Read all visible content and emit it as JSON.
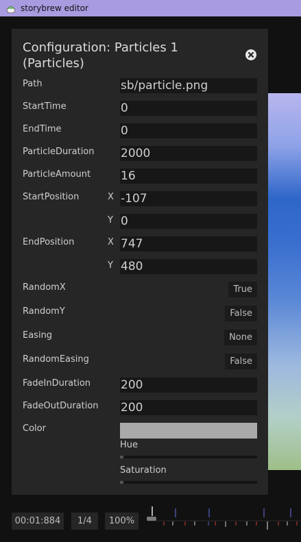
{
  "window": {
    "title": "storybrew editor"
  },
  "config": {
    "title": "Configuration: Particles 1 (Particles)",
    "fields": [
      {
        "label": "Path",
        "value": "sb/particle.png"
      },
      {
        "label": "StartTime",
        "value": "0"
      },
      {
        "label": "EndTime",
        "value": "0"
      },
      {
        "label": "ParticleDuration",
        "value": "2000"
      },
      {
        "label": "ParticleAmount",
        "value": "16"
      }
    ],
    "start_position": {
      "label": "StartPosition",
      "x_label": "X",
      "x": "-107",
      "y_label": "Y",
      "y": "0"
    },
    "end_position": {
      "label": "EndPosition",
      "x_label": "X",
      "x": "747",
      "y_label": "Y",
      "y": "480"
    },
    "toggles": [
      {
        "label": "RandomX",
        "value": "True"
      },
      {
        "label": "RandomY",
        "value": "False"
      },
      {
        "label": "Easing",
        "value": "None"
      },
      {
        "label": "RandomEasing",
        "value": "False"
      }
    ],
    "fade_in": {
      "label": "FadeInDuration",
      "value": "200"
    },
    "fade_out": {
      "label": "FadeOutDuration",
      "value": "200"
    },
    "color": {
      "label": "Color",
      "swatch": "#a9a9a9",
      "hue_label": "Hue",
      "hue": 0,
      "saturation_label": "Saturation",
      "saturation": 0
    }
  },
  "statusbar": {
    "time": "00:01:884",
    "page": "1/4",
    "zoom": "100%"
  }
}
